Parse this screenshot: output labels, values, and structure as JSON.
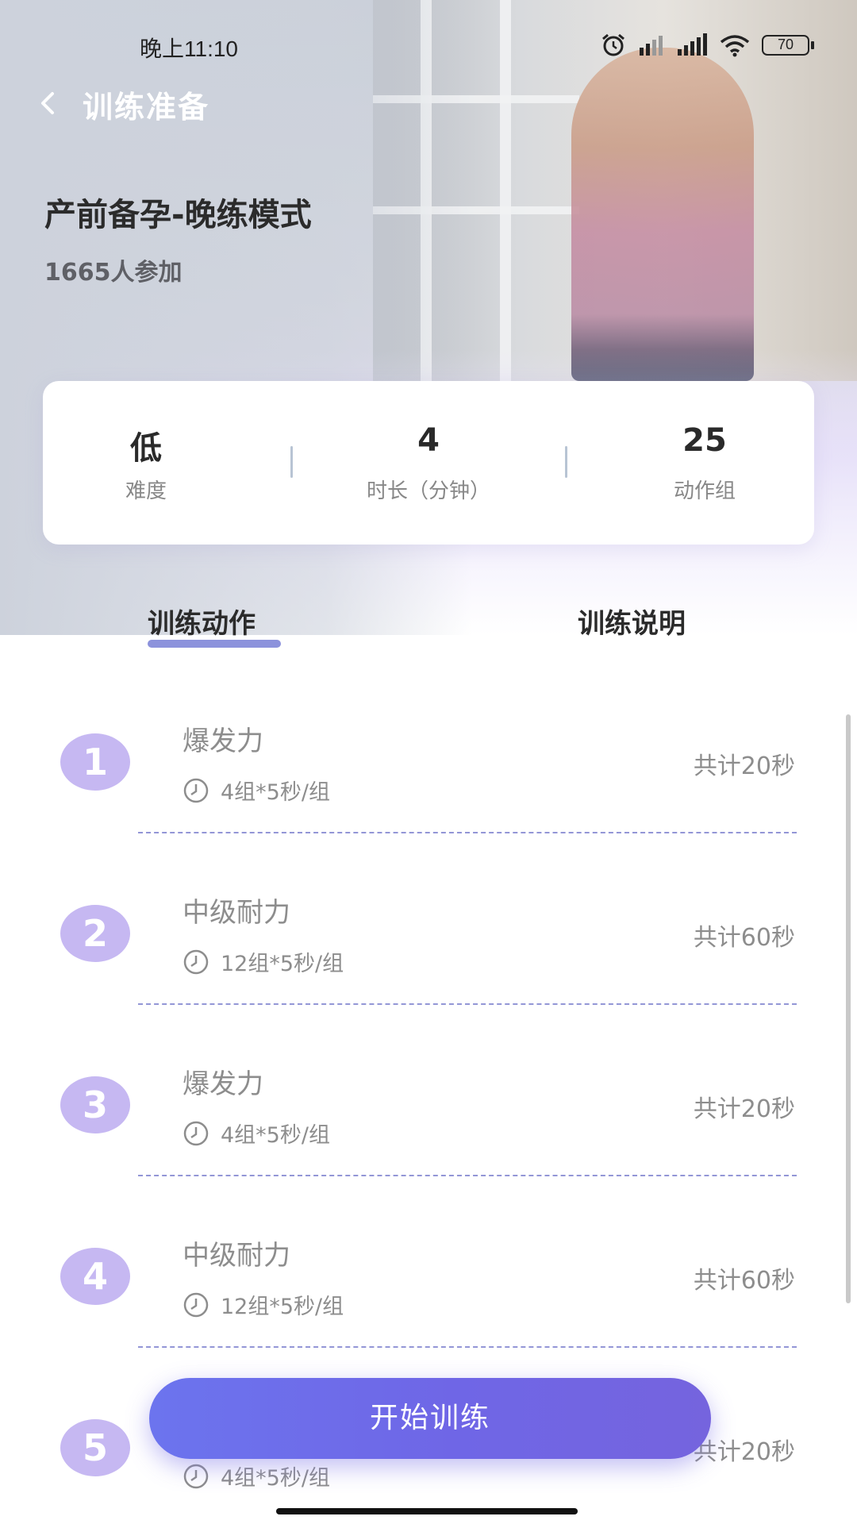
{
  "status_bar": {
    "time": "晚上11:10",
    "icons": [
      "alarm-icon",
      "hd-signal-icon",
      "signal-icon",
      "wifi-icon",
      "battery-icon"
    ],
    "battery": "70"
  },
  "nav": {
    "back_icon": "chevron-left-icon",
    "title": "训练准备"
  },
  "plan": {
    "title": "产前备孕-晚练模式",
    "participants": "1665人参加"
  },
  "stats": [
    {
      "value": "低",
      "label": "难度"
    },
    {
      "value": "4",
      "label": "时长（分钟）"
    },
    {
      "value": "25",
      "label": "动作组"
    }
  ],
  "tabs": [
    {
      "label": "训练动作",
      "active": true
    },
    {
      "label": "训练说明",
      "active": false
    }
  ],
  "exercises": [
    {
      "number": "1",
      "name": "爆发力",
      "detail": "4组*5秒/组",
      "total": "共计20秒"
    },
    {
      "number": "2",
      "name": "中级耐力",
      "detail": "12组*5秒/组",
      "total": "共计60秒"
    },
    {
      "number": "3",
      "name": "爆发力",
      "detail": "4组*5秒/组",
      "total": "共计20秒"
    },
    {
      "number": "4",
      "name": "中级耐力",
      "detail": "12组*5秒/组",
      "total": "共计60秒"
    },
    {
      "number": "5",
      "name": "",
      "detail": "4组*5秒/组",
      "total": "共计20秒"
    }
  ],
  "start_button": {
    "label": "开始训练"
  },
  "colors": {
    "accent": "#6c74ee",
    "number_badge": "#c6b8f2",
    "tab_underline": "#8c92dc",
    "divider": "#6f74c9"
  }
}
